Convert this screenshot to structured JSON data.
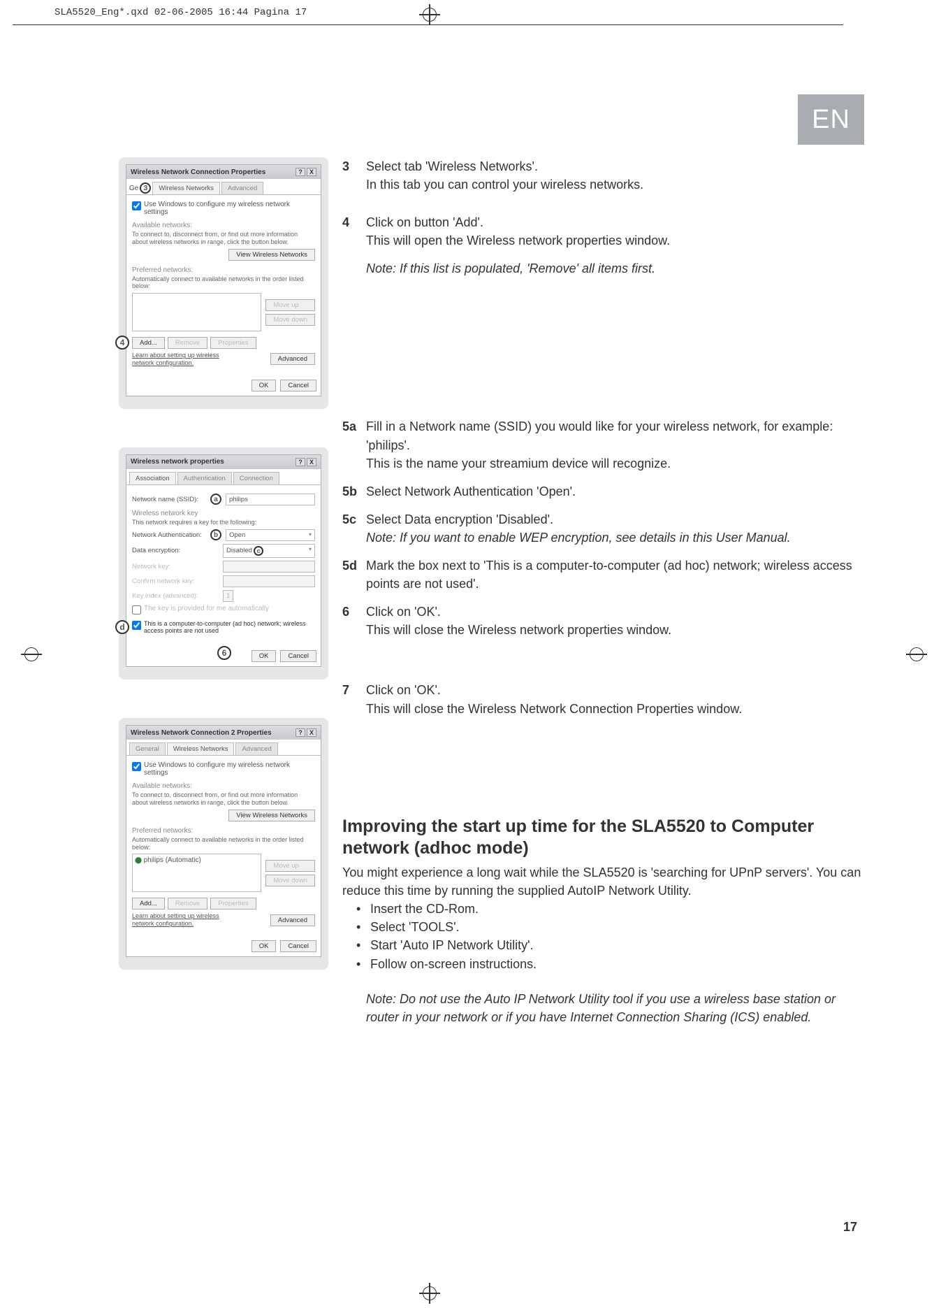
{
  "header_line": "SLA5520_Eng*.qxd  02-06-2005  16:44  Pagina 17",
  "lang_badge": "EN",
  "page_number": "17",
  "screenshot1": {
    "title": "Wireless Network Connection Properties",
    "tab_general_prefix": "Ge",
    "tab_wireless": "Wireless Networks",
    "tab_advanced": "Advanced",
    "chk_use": "Use Windows to configure my wireless network settings",
    "available_label": "Available networks:",
    "available_hint": "To connect to, disconnect from, or find out more information about wireless networks in range, click the button below.",
    "btn_view": "View Wireless Networks",
    "preferred_label": "Preferred networks:",
    "preferred_hint": "Automatically connect to available networks in the order listed below:",
    "btn_moveup": "Move up",
    "btn_movedown": "Move down",
    "btn_add": "Add...",
    "btn_remove": "Remove",
    "btn_properties": "Properties",
    "learn": "Learn about setting up wireless network configuration.",
    "btn_advanced": "Advanced",
    "btn_ok": "OK",
    "btn_cancel": "Cancel",
    "marker3": "3",
    "marker4": "4"
  },
  "screenshot2": {
    "title": "Wireless network properties",
    "tab_assoc": "Association",
    "tab_auth": "Authentication",
    "tab_conn": "Connection",
    "ssid_label": "Network name (SSID):",
    "ssid_value": "philips",
    "key_section": "Wireless network key",
    "key_hint": "This network requires a key for the following:",
    "auth_label": "Network Authentication:",
    "auth_value": "Open",
    "enc_label": "Data encryption:",
    "enc_value": "Disabled",
    "netkey_label": "Network key:",
    "confirm_label": "Confirm network key:",
    "index_label": "Key index (advanced):",
    "index_value": "1",
    "autokey": "The key is provided for me automatically",
    "adhoc": "This is a computer-to-computer (ad hoc) network; wireless access points are not used",
    "btn_ok": "OK",
    "btn_cancel": "Cancel",
    "marker_a": "a",
    "marker_b": "b",
    "marker_c": "c",
    "marker_d": "d",
    "marker_6": "6"
  },
  "screenshot3": {
    "title": "Wireless Network Connection 2 Properties",
    "tab_general": "General",
    "tab_wireless": "Wireless Networks",
    "tab_advanced": "Advanced",
    "chk_use": "Use Windows to configure my wireless network settings",
    "available_label": "Available networks:",
    "available_hint": "To connect to, disconnect from, or find out more information about wireless networks in range, click the button below.",
    "btn_view": "View Wireless Networks",
    "preferred_label": "Preferred networks:",
    "preferred_hint": "Automatically connect to available networks in the order listed below:",
    "list_item": "philips (Automatic)",
    "btn_moveup": "Move up",
    "btn_movedown": "Move down",
    "btn_add": "Add...",
    "btn_remove": "Remove",
    "btn_properties": "Properties",
    "learn": "Learn about setting up wireless network configuration.",
    "btn_advanced": "Advanced",
    "btn_ok": "OK",
    "btn_cancel": "Cancel"
  },
  "steps": {
    "s3_num": "3",
    "s3_a": "Select tab 'Wireless Networks'.",
    "s3_b": "In this tab you can control your wireless networks.",
    "s4_num": "4",
    "s4_a": "Click on button 'Add'.",
    "s4_b": "This will open the Wireless network properties window.",
    "s4_note": "Note: If this list is populated, 'Remove' all items first.",
    "s5a_num": "5a",
    "s5a_a": "Fill in a Network name (SSID) you would like for your wireless network, for example: 'philips'.",
    "s5a_b": "This is the name your streamium device will recognize.",
    "s5b_num": "5b",
    "s5b_a": "Select Network Authentication 'Open'.",
    "s5c_num": "5c",
    "s5c_a": "Select Data encryption 'Disabled'.",
    "s5c_note": "Note: If you want to enable WEP encryption, see details in this User Manual.",
    "s5d_num": "5d",
    "s5d_a": "Mark the box next to 'This is a computer-to-computer (ad hoc) network; wireless access points are not used'.",
    "s6_num": "6",
    "s6_a": "Click on 'OK'.",
    "s6_b": "This will close the Wireless network properties window.",
    "s7_num": "7",
    "s7_a": "Click on 'OK'.",
    "s7_b": "This will close the Wireless Network Connection Properties window."
  },
  "improving": {
    "heading": "Improving the start up time for the SLA5520 to Computer network (adhoc mode)",
    "p1": "You might experience a long wait while the SLA5520 is 'searching for UPnP servers'. You can reduce this time by running the supplied AutoIP Network Utility.",
    "b1": "Insert the CD-Rom.",
    "b2": "Select 'TOOLS'.",
    "b3": "Start 'Auto IP Network Utility'.",
    "b4": "Follow on-screen instructions.",
    "note": "Note: Do not use the Auto IP Network Utility tool if you use a wireless base station or router in your network or if you have Internet Connection Sharing (ICS) enabled."
  }
}
